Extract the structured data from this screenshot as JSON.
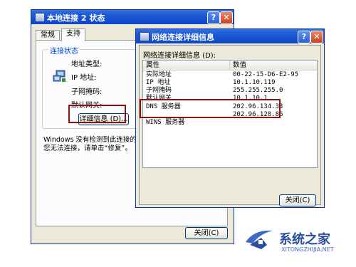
{
  "window1": {
    "title": "本地连接 2 状态",
    "help_btn": "?",
    "close_btn": "✕",
    "tabs": [
      {
        "label": "常规"
      },
      {
        "label": "支持"
      }
    ],
    "group_title": "连接状态",
    "fields": [
      {
        "label": "地址类型:"
      },
      {
        "label": "IP 地址:"
      },
      {
        "label": "子网掩码:"
      },
      {
        "label": "默认网关:"
      }
    ],
    "details_button": "详细信息 (D)...",
    "status_lines": [
      "Windows 没有检测到此连接的问题。如果",
      "您无法连接，请单击“修复”。"
    ],
    "close_button": "关闭(C)"
  },
  "window2": {
    "title": "网络连接详细信息",
    "help_btn": "?",
    "close_btn": "✕",
    "caption": "网络连接详细信息 (D):",
    "columns": {
      "property": "属性",
      "value": "数值"
    },
    "rows": [
      {
        "property": "实际地址",
        "value": "00-22-15-D6-E2-95"
      },
      {
        "property": "IP 地址",
        "value": "10.1.10.119"
      },
      {
        "property": "子网掩码",
        "value": "255.255.255.0"
      },
      {
        "property": "默认网关",
        "value": "10.1.10.1"
      },
      {
        "property": "DNS 服务器",
        "value": "202.96.134.33"
      },
      {
        "property": "",
        "value": "202.96.128.86"
      },
      {
        "property": "WINS 服务器",
        "value": ""
      }
    ],
    "close_button": "关闭(C)"
  },
  "watermark": {
    "text": "系统之家",
    "url": "XITONGZHIJIA.NET"
  },
  "colors": {
    "titlebar": "#0a46c8",
    "highlight": "#8b1010",
    "dialog_bg": "#ece9d8"
  }
}
